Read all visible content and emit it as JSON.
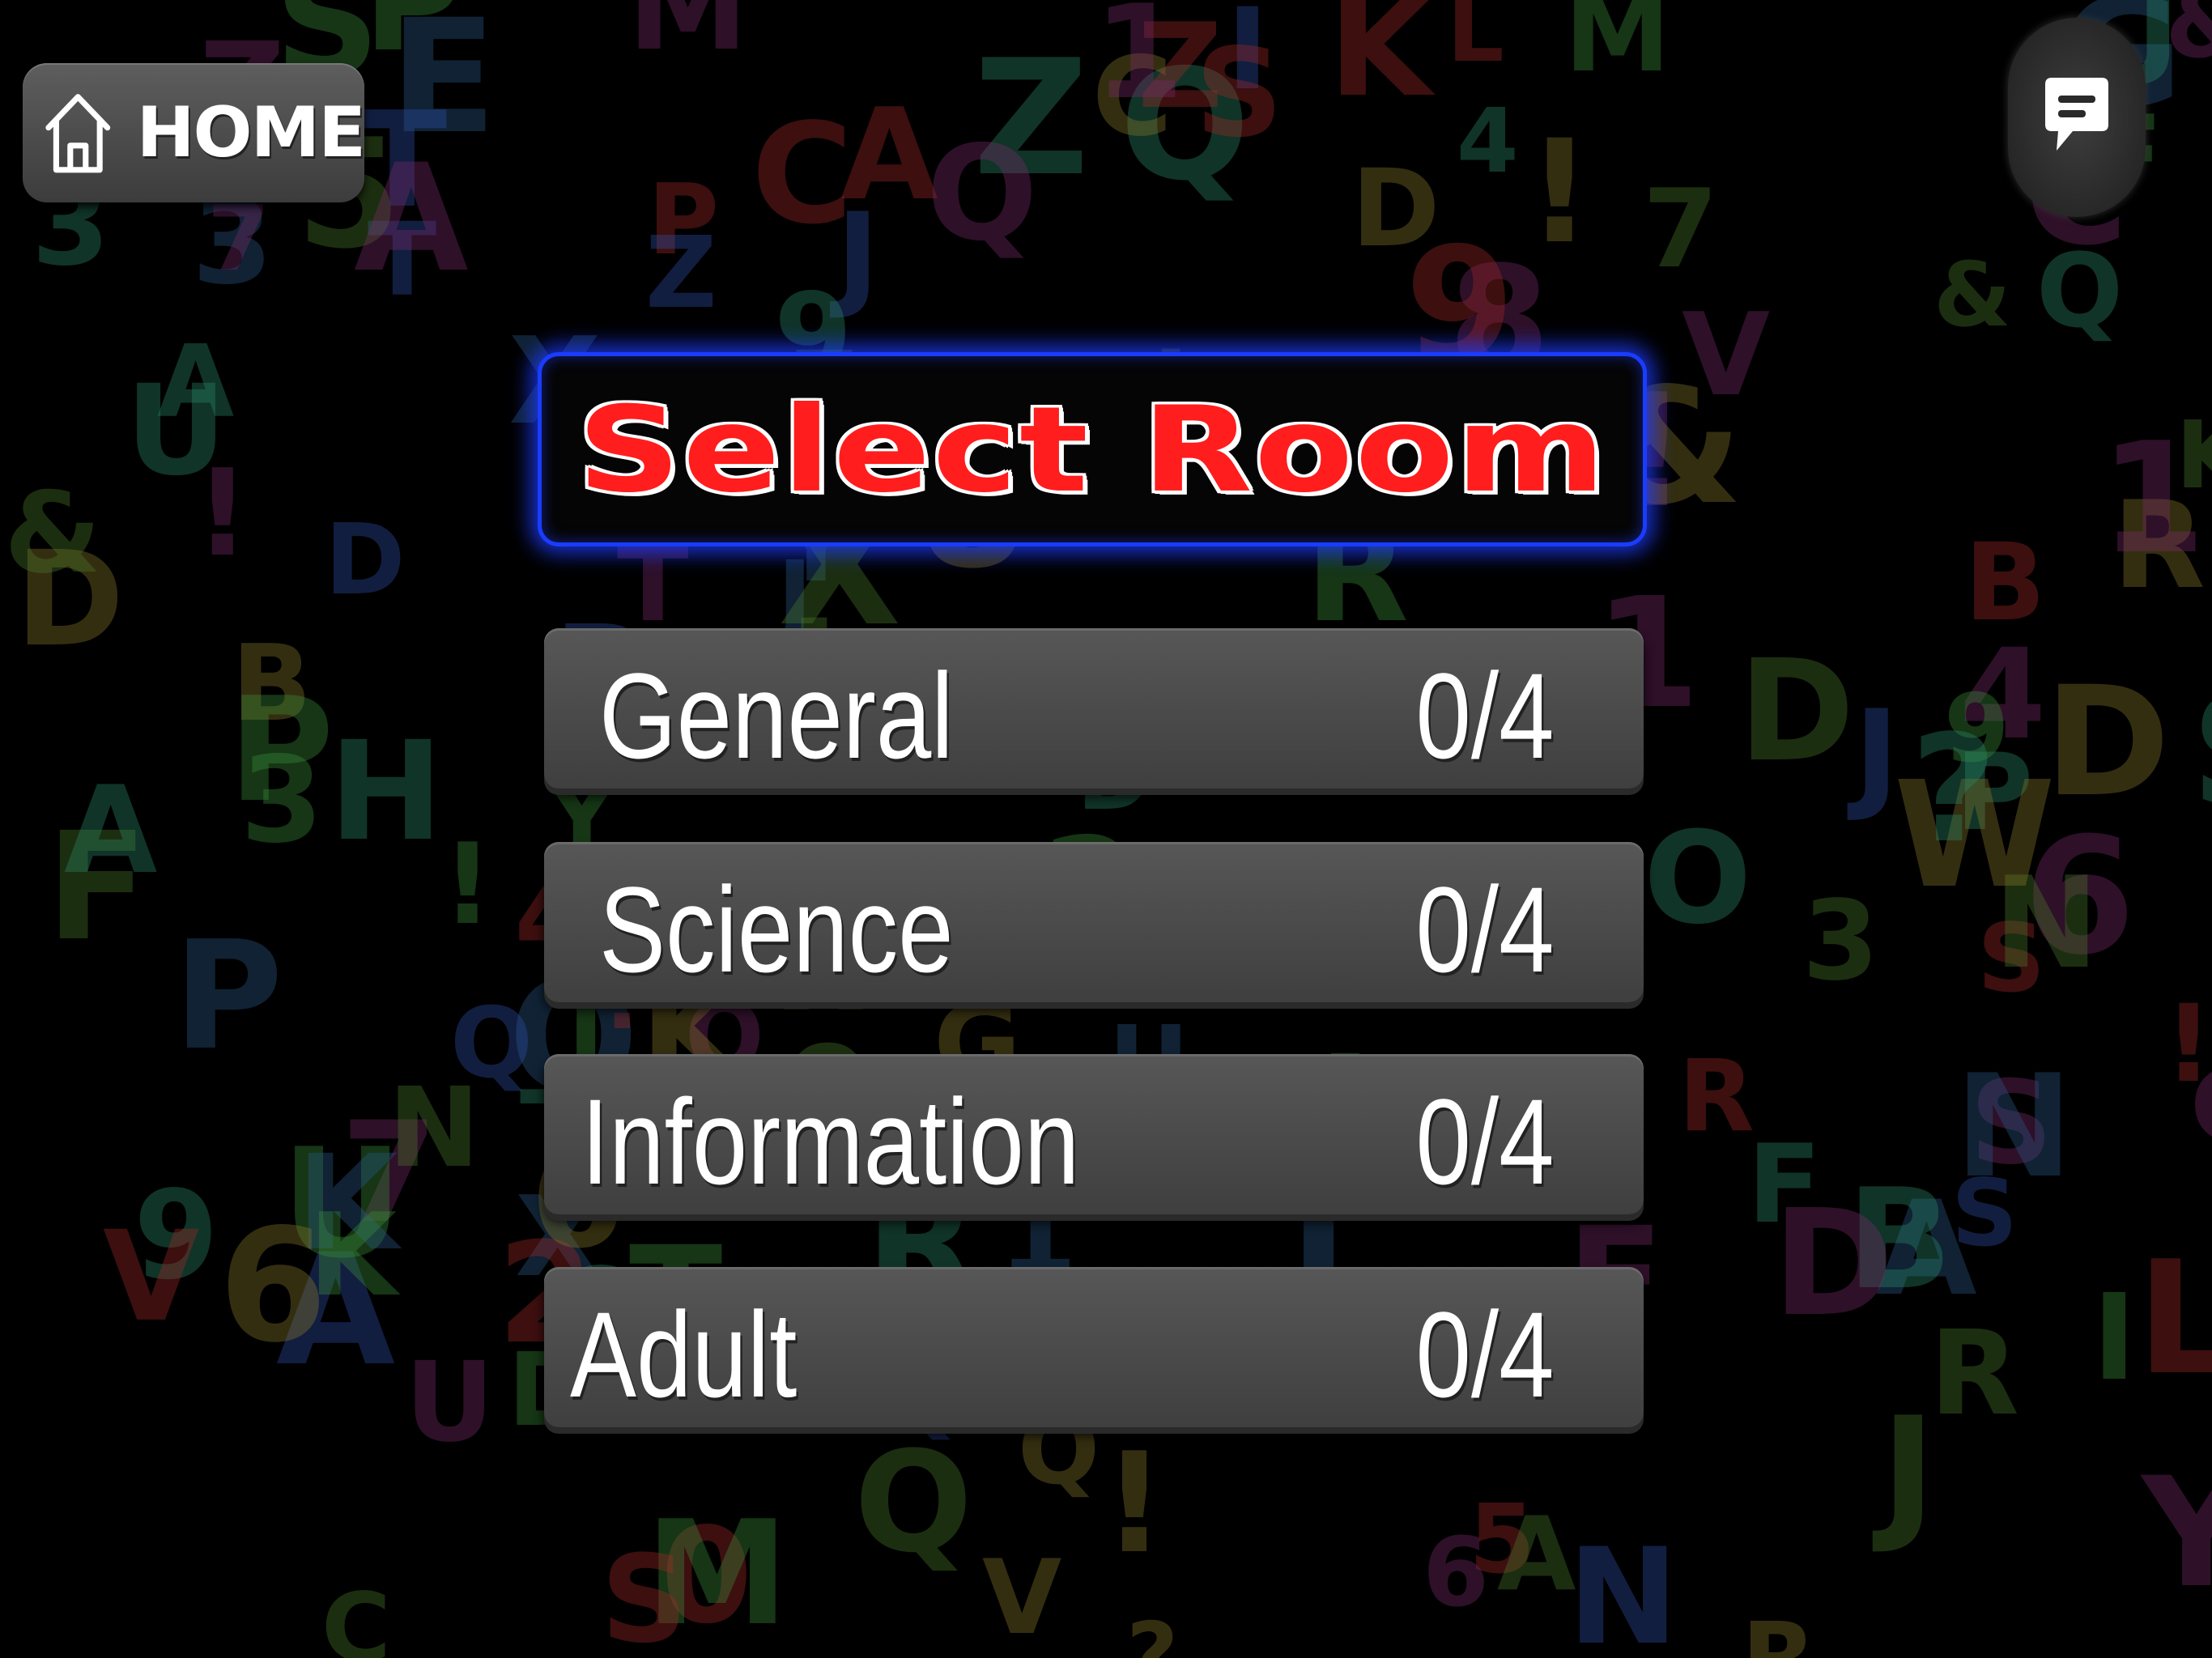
{
  "header": {
    "home_label": "HOME",
    "home_icon": "house-outline",
    "chat_icon": "chat-bubble"
  },
  "title": "Select Room",
  "rooms": [
    {
      "name": "General",
      "count": "0/4"
    },
    {
      "name": "Science",
      "count": "0/4"
    },
    {
      "name": "Information",
      "count": "0/4"
    },
    {
      "name": "Adult",
      "count": "0/4"
    }
  ],
  "colors": {
    "title_red": "#ff1d1d",
    "panel_glow_blue": "#1a3cff",
    "button_gray": "#4a4a4a",
    "background": "#000000"
  },
  "background_pattern": "scattered colorful balloon letters"
}
